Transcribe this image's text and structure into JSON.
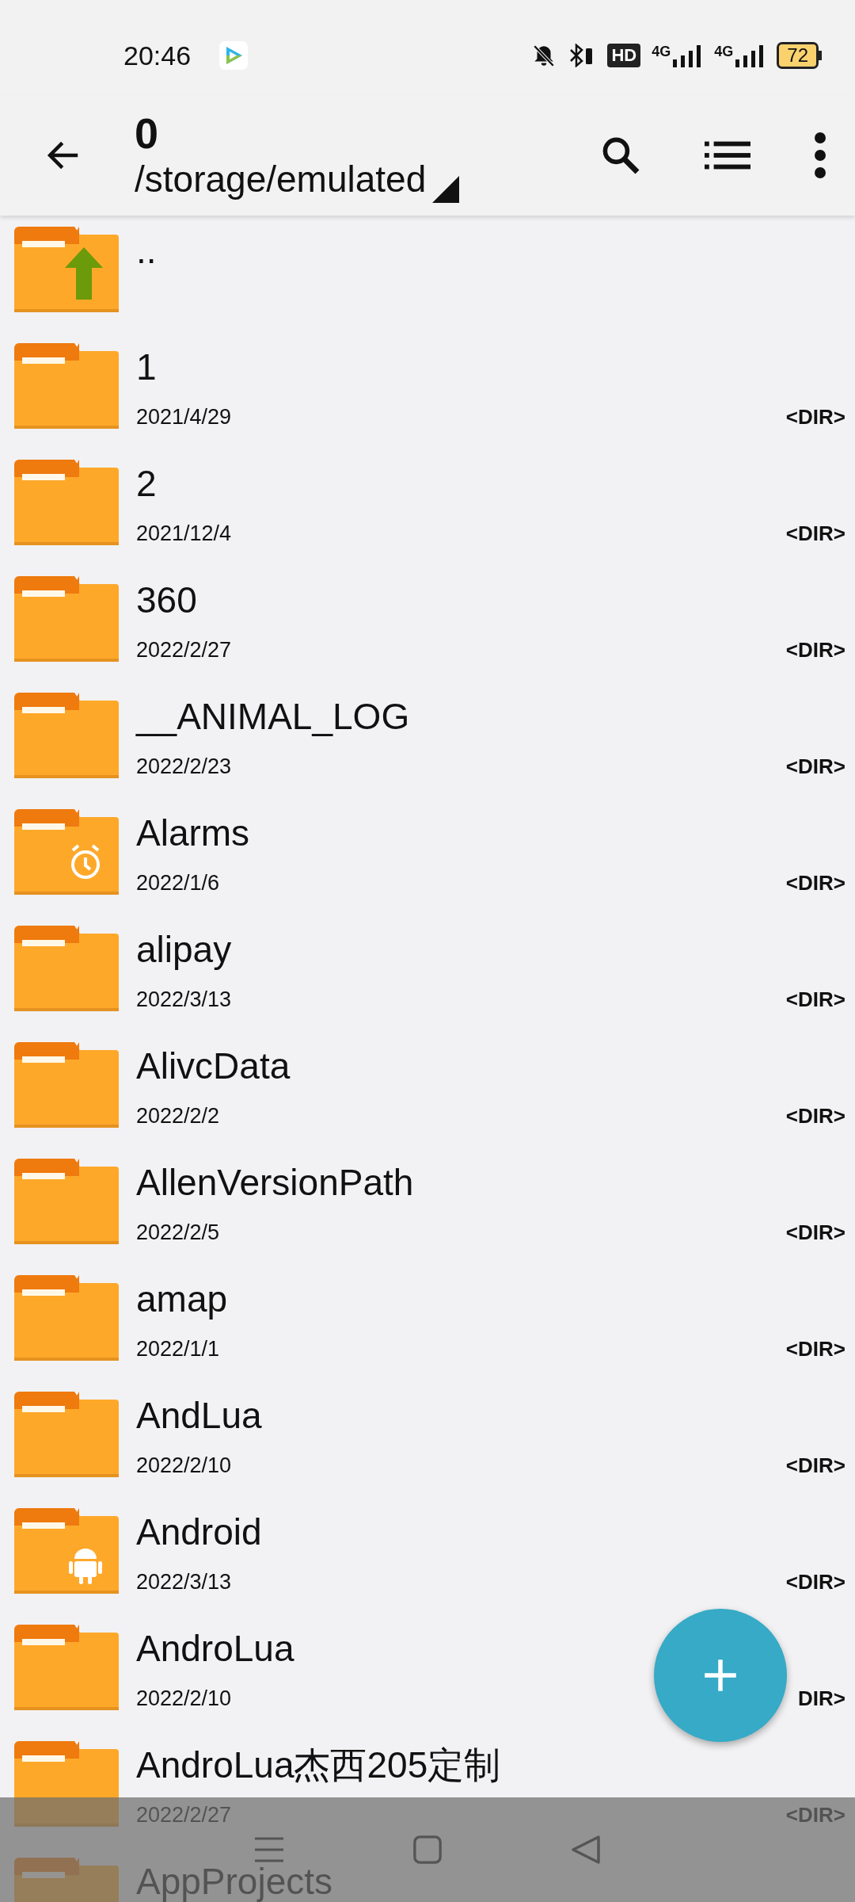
{
  "status_bar": {
    "time": "20:46",
    "hd_label": "HD",
    "network_labels": [
      "4G",
      "4G"
    ],
    "battery": "72"
  },
  "toolbar": {
    "title": "0",
    "path": "/storage/emulated"
  },
  "files": [
    {
      "name": "..",
      "kind": "up"
    },
    {
      "name": "1",
      "date": "2021/4/29",
      "type": "<DIR>",
      "kind": "plain"
    },
    {
      "name": "2",
      "date": "2021/12/4",
      "type": "<DIR>",
      "kind": "plain"
    },
    {
      "name": "360",
      "date": "2022/2/27",
      "type": "<DIR>",
      "kind": "plain"
    },
    {
      "name": "__ANIMAL_LOG",
      "date": "2022/2/23",
      "type": "<DIR>",
      "kind": "plain"
    },
    {
      "name": "Alarms",
      "date": "2022/1/6",
      "type": "<DIR>",
      "kind": "alarm"
    },
    {
      "name": "alipay",
      "date": "2022/3/13",
      "type": "<DIR>",
      "kind": "plain"
    },
    {
      "name": "AlivcData",
      "date": "2022/2/2",
      "type": "<DIR>",
      "kind": "plain"
    },
    {
      "name": "AllenVersionPath",
      "date": "2022/2/5",
      "type": "<DIR>",
      "kind": "plain"
    },
    {
      "name": "amap",
      "date": "2022/1/1",
      "type": "<DIR>",
      "kind": "plain"
    },
    {
      "name": "AndLua",
      "date": "2022/2/10",
      "type": "<DIR>",
      "kind": "plain"
    },
    {
      "name": "Android",
      "date": "2022/3/13",
      "type": "<DIR>",
      "kind": "android"
    },
    {
      "name": "AndroLua",
      "date": "2022/2/10",
      "type": "DIR>",
      "kind": "plain"
    },
    {
      "name": "AndroLua杰西205定制",
      "date": "2022/2/27",
      "type": "<DIR>",
      "kind": "plain"
    },
    {
      "name": "AppProjects",
      "kind": "plain"
    }
  ]
}
